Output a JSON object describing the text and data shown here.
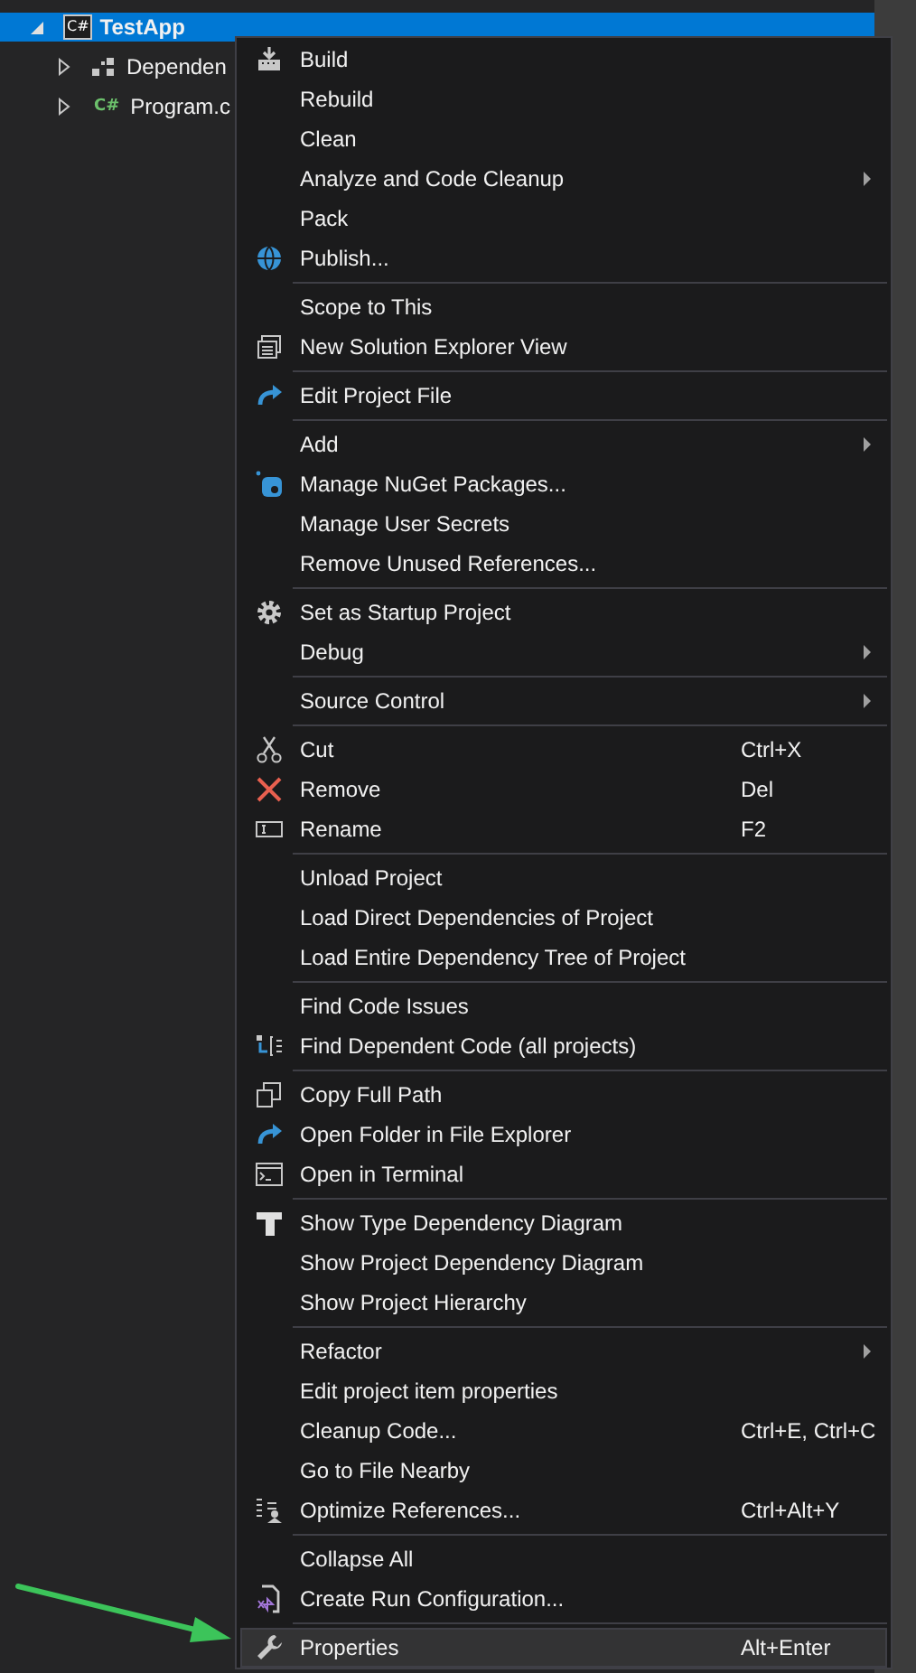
{
  "tree": [
    {
      "label": "TestApp",
      "kind": "project",
      "badge": "C#",
      "expanded": true,
      "selected": true,
      "children": [
        {
          "label": "Dependen",
          "kind": "dependencies",
          "expanded": false,
          "selected": false
        },
        {
          "label": "Program.c",
          "kind": "csharp-file",
          "badge": "C#",
          "expanded": false,
          "selected": false
        }
      ]
    }
  ],
  "context_menu": {
    "groups": [
      {
        "items": [
          {
            "label": "Build",
            "kind": "build",
            "submenu": false,
            "selected": false
          },
          {
            "label": "Rebuild",
            "kind": "plain",
            "submenu": false,
            "selected": false
          },
          {
            "label": "Clean",
            "kind": "plain",
            "submenu": false,
            "selected": false
          },
          {
            "label": "Analyze and Code Cleanup",
            "kind": "plain",
            "submenu": true,
            "selected": false
          },
          {
            "label": "Pack",
            "kind": "plain",
            "submenu": false,
            "selected": false
          },
          {
            "label": "Publish...",
            "kind": "globe",
            "submenu": false,
            "selected": false
          }
        ]
      },
      {
        "items": [
          {
            "label": "Scope to This",
            "kind": "plain",
            "submenu": false,
            "selected": false
          },
          {
            "label": "New Solution Explorer View",
            "kind": "window",
            "submenu": false,
            "selected": false
          }
        ]
      },
      {
        "items": [
          {
            "label": "Edit Project File",
            "kind": "curved-arrow",
            "submenu": false,
            "selected": false
          }
        ]
      },
      {
        "items": [
          {
            "label": "Add",
            "kind": "plain",
            "submenu": true,
            "selected": false
          },
          {
            "label": "Manage NuGet Packages...",
            "kind": "package",
            "submenu": false,
            "selected": false
          },
          {
            "label": "Manage User Secrets",
            "kind": "plain",
            "submenu": false,
            "selected": false
          },
          {
            "label": "Remove Unused References...",
            "kind": "plain",
            "submenu": false,
            "selected": false
          }
        ]
      },
      {
        "items": [
          {
            "label": "Set as Startup Project",
            "kind": "gear",
            "submenu": false,
            "selected": false
          },
          {
            "label": "Debug",
            "kind": "plain",
            "submenu": true,
            "selected": false
          }
        ]
      },
      {
        "items": [
          {
            "label": "Source Control",
            "kind": "plain",
            "submenu": true,
            "selected": false
          }
        ]
      },
      {
        "items": [
          {
            "label": "Cut",
            "kind": "scissors",
            "shortcut": "Ctrl+X",
            "submenu": false,
            "selected": false
          },
          {
            "label": "Remove",
            "kind": "cross",
            "shortcut": "Del",
            "submenu": false,
            "selected": false
          },
          {
            "label": "Rename",
            "kind": "rename",
            "shortcut": "F2",
            "submenu": false,
            "selected": false
          }
        ]
      },
      {
        "items": [
          {
            "label": "Unload Project",
            "kind": "plain",
            "submenu": false,
            "selected": false
          },
          {
            "label": "Load Direct Dependencies of Project",
            "kind": "plain",
            "submenu": false,
            "selected": false
          },
          {
            "label": "Load Entire Dependency Tree of Project",
            "kind": "plain",
            "submenu": false,
            "selected": false
          }
        ]
      },
      {
        "items": [
          {
            "label": "Find Code Issues",
            "kind": "plain",
            "submenu": false,
            "selected": false
          },
          {
            "label": "Find Dependent Code (all projects)",
            "kind": "dependents",
            "submenu": false,
            "selected": false
          }
        ]
      },
      {
        "items": [
          {
            "label": "Copy Full Path",
            "kind": "copy",
            "submenu": false,
            "selected": false
          },
          {
            "label": "Open Folder in File Explorer",
            "kind": "curved-arrow",
            "submenu": false,
            "selected": false
          },
          {
            "label": "Open in Terminal",
            "kind": "terminal",
            "submenu": false,
            "selected": false
          }
        ]
      },
      {
        "items": [
          {
            "label": "Show Type Dependency Diagram",
            "kind": "letter-t",
            "submenu": false,
            "selected": false
          },
          {
            "label": "Show Project Dependency Diagram",
            "kind": "plain",
            "submenu": false,
            "selected": false
          },
          {
            "label": "Show Project Hierarchy",
            "kind": "plain",
            "submenu": false,
            "selected": false
          }
        ]
      },
      {
        "items": [
          {
            "label": "Refactor",
            "kind": "plain",
            "submenu": true,
            "selected": false
          },
          {
            "label": "Edit project item properties",
            "kind": "plain",
            "submenu": false,
            "selected": false
          },
          {
            "label": "Cleanup Code...",
            "kind": "plain",
            "shortcut": "Ctrl+E, Ctrl+C",
            "submenu": false,
            "selected": false
          },
          {
            "label": "Go to File Nearby",
            "kind": "plain",
            "submenu": false,
            "selected": false
          },
          {
            "label": "Optimize References...",
            "kind": "optimize",
            "shortcut": "Ctrl+Alt+Y",
            "submenu": false,
            "selected": false
          }
        ]
      },
      {
        "items": [
          {
            "label": "Collapse All",
            "kind": "plain",
            "submenu": false,
            "selected": false
          },
          {
            "label": "Create Run Configuration...",
            "kind": "run-file",
            "submenu": false,
            "selected": false
          }
        ]
      },
      {
        "items": [
          {
            "label": "Properties",
            "kind": "wrench",
            "shortcut": "Alt+Enter",
            "submenu": false,
            "selected": true
          }
        ]
      }
    ]
  }
}
